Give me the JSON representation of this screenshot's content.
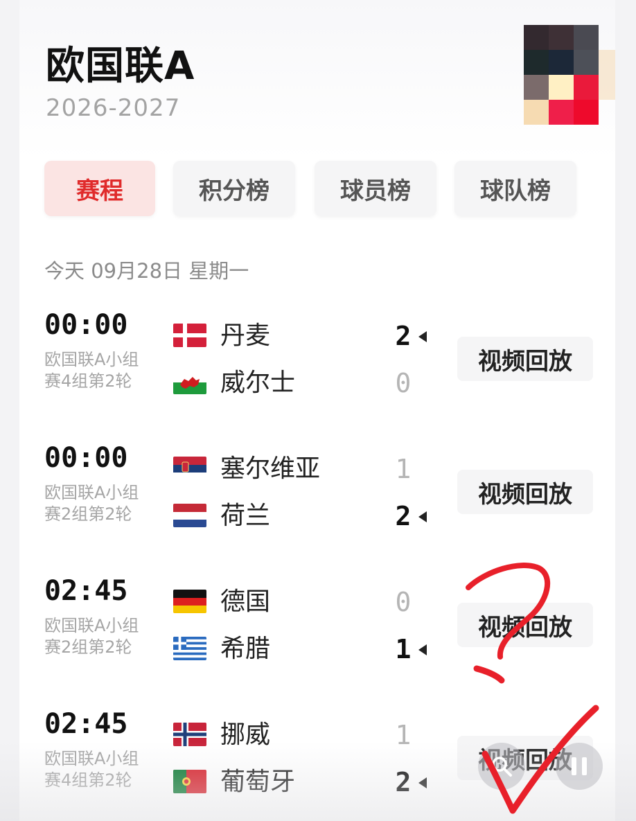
{
  "header": {
    "title": "欧国联A",
    "season": "2026-2027",
    "logo_colors": [
      "#33292f",
      "#3e3036",
      "#4a4a52",
      "#1e2a2c",
      "#1c2838",
      "#4d5058",
      "#7b6b6b",
      "#fff0c4",
      "#ea1a3b",
      "#f6dbb2",
      "#ef1f4a",
      "#ee0a2c"
    ]
  },
  "tabs": [
    {
      "label": "赛程",
      "active": true
    },
    {
      "label": "积分榜",
      "active": false
    },
    {
      "label": "球员榜",
      "active": false
    },
    {
      "label": "球队榜",
      "active": false
    }
  ],
  "date_header": "今天 09月28日 星期一",
  "matches": [
    {
      "time": "00:00",
      "desc": "欧国联A小组赛4组第2轮",
      "replay_label": "视频回放",
      "home": {
        "name": "丹麦",
        "score": "2",
        "winner": true,
        "flag": "denmark"
      },
      "away": {
        "name": "威尔士",
        "score": "0",
        "winner": false,
        "flag": "wales"
      }
    },
    {
      "time": "00:00",
      "desc": "欧国联A小组赛2组第2轮",
      "replay_label": "视频回放",
      "home": {
        "name": "塞尔维亚",
        "score": "1",
        "winner": false,
        "flag": "serbia"
      },
      "away": {
        "name": "荷兰",
        "score": "2",
        "winner": true,
        "flag": "netherlands"
      }
    },
    {
      "time": "02:45",
      "desc": "欧国联A小组赛2组第2轮",
      "replay_label": "视频回放",
      "home": {
        "name": "德国",
        "score": "0",
        "winner": false,
        "flag": "germany"
      },
      "away": {
        "name": "希腊",
        "score": "1",
        "winner": true,
        "flag": "greece"
      }
    },
    {
      "time": "02:45",
      "desc": "欧国联A小组赛4组第2轮",
      "replay_label": "视频回放",
      "home": {
        "name": "挪威",
        "score": "1",
        "winner": false,
        "flag": "norway"
      },
      "away": {
        "name": "葡萄牙",
        "score": "2",
        "winner": true,
        "flag": "portugal"
      }
    }
  ],
  "floating": {
    "search_icon": "magnifier-icon",
    "pause_icon": "pause-icon"
  },
  "annotations": {
    "question_mark_color": "#e8202a",
    "check_mark_color": "#e8202a"
  }
}
